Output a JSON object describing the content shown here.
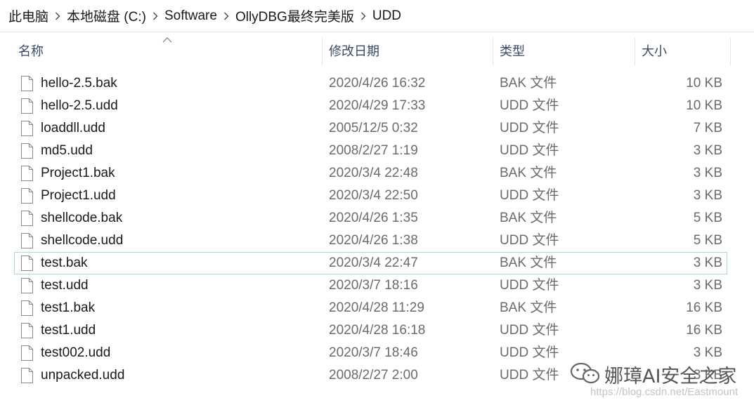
{
  "breadcrumb": [
    "此电脑",
    "本地磁盘 (C:)",
    "Software",
    "OllyDBG最终完美版",
    "UDD"
  ],
  "columns": {
    "name": "名称",
    "date": "修改日期",
    "type": "类型",
    "size": "大小",
    "sorted_by": "name"
  },
  "files": [
    {
      "name": "hello-2.5.bak",
      "date": "2020/4/26 16:32",
      "type": "BAK 文件",
      "size": "10 KB"
    },
    {
      "name": "hello-2.5.udd",
      "date": "2020/4/29 17:33",
      "type": "UDD 文件",
      "size": "10 KB"
    },
    {
      "name": "loaddll.udd",
      "date": "2005/12/5 0:32",
      "type": "UDD 文件",
      "size": "7 KB"
    },
    {
      "name": "md5.udd",
      "date": "2008/2/27 1:19",
      "type": "UDD 文件",
      "size": "3 KB"
    },
    {
      "name": "Project1.bak",
      "date": "2020/3/4 22:48",
      "type": "BAK 文件",
      "size": "3 KB"
    },
    {
      "name": "Project1.udd",
      "date": "2020/3/4 22:50",
      "type": "UDD 文件",
      "size": "3 KB"
    },
    {
      "name": "shellcode.bak",
      "date": "2020/4/26 1:35",
      "type": "BAK 文件",
      "size": "5 KB"
    },
    {
      "name": "shellcode.udd",
      "date": "2020/4/26 1:38",
      "type": "UDD 文件",
      "size": "5 KB"
    },
    {
      "name": "test.bak",
      "date": "2020/3/4 22:47",
      "type": "BAK 文件",
      "size": "3 KB",
      "selected": true
    },
    {
      "name": "test.udd",
      "date": "2020/3/7 18:16",
      "type": "UDD 文件",
      "size": "3 KB"
    },
    {
      "name": "test1.bak",
      "date": "2020/4/28 11:29",
      "type": "BAK 文件",
      "size": "16 KB"
    },
    {
      "name": "test1.udd",
      "date": "2020/4/28 16:18",
      "type": "UDD 文件",
      "size": "16 KB"
    },
    {
      "name": "test002.udd",
      "date": "2020/3/7 18:46",
      "type": "UDD 文件",
      "size": "3 KB"
    },
    {
      "name": "unpacked.udd",
      "date": "2008/2/27 2:00",
      "type": "UDD 文件",
      "size": "3 KB"
    }
  ],
  "watermark": {
    "brand": "娜璋AI安全之家",
    "url": "https://blog.csdn.net/Eastmount",
    "icon": "wechat-logo-icon"
  },
  "colors": {
    "selection_border": "#a9d8e3",
    "header_text": "#3a4a66",
    "secondary_text": "#6b6b6b"
  }
}
